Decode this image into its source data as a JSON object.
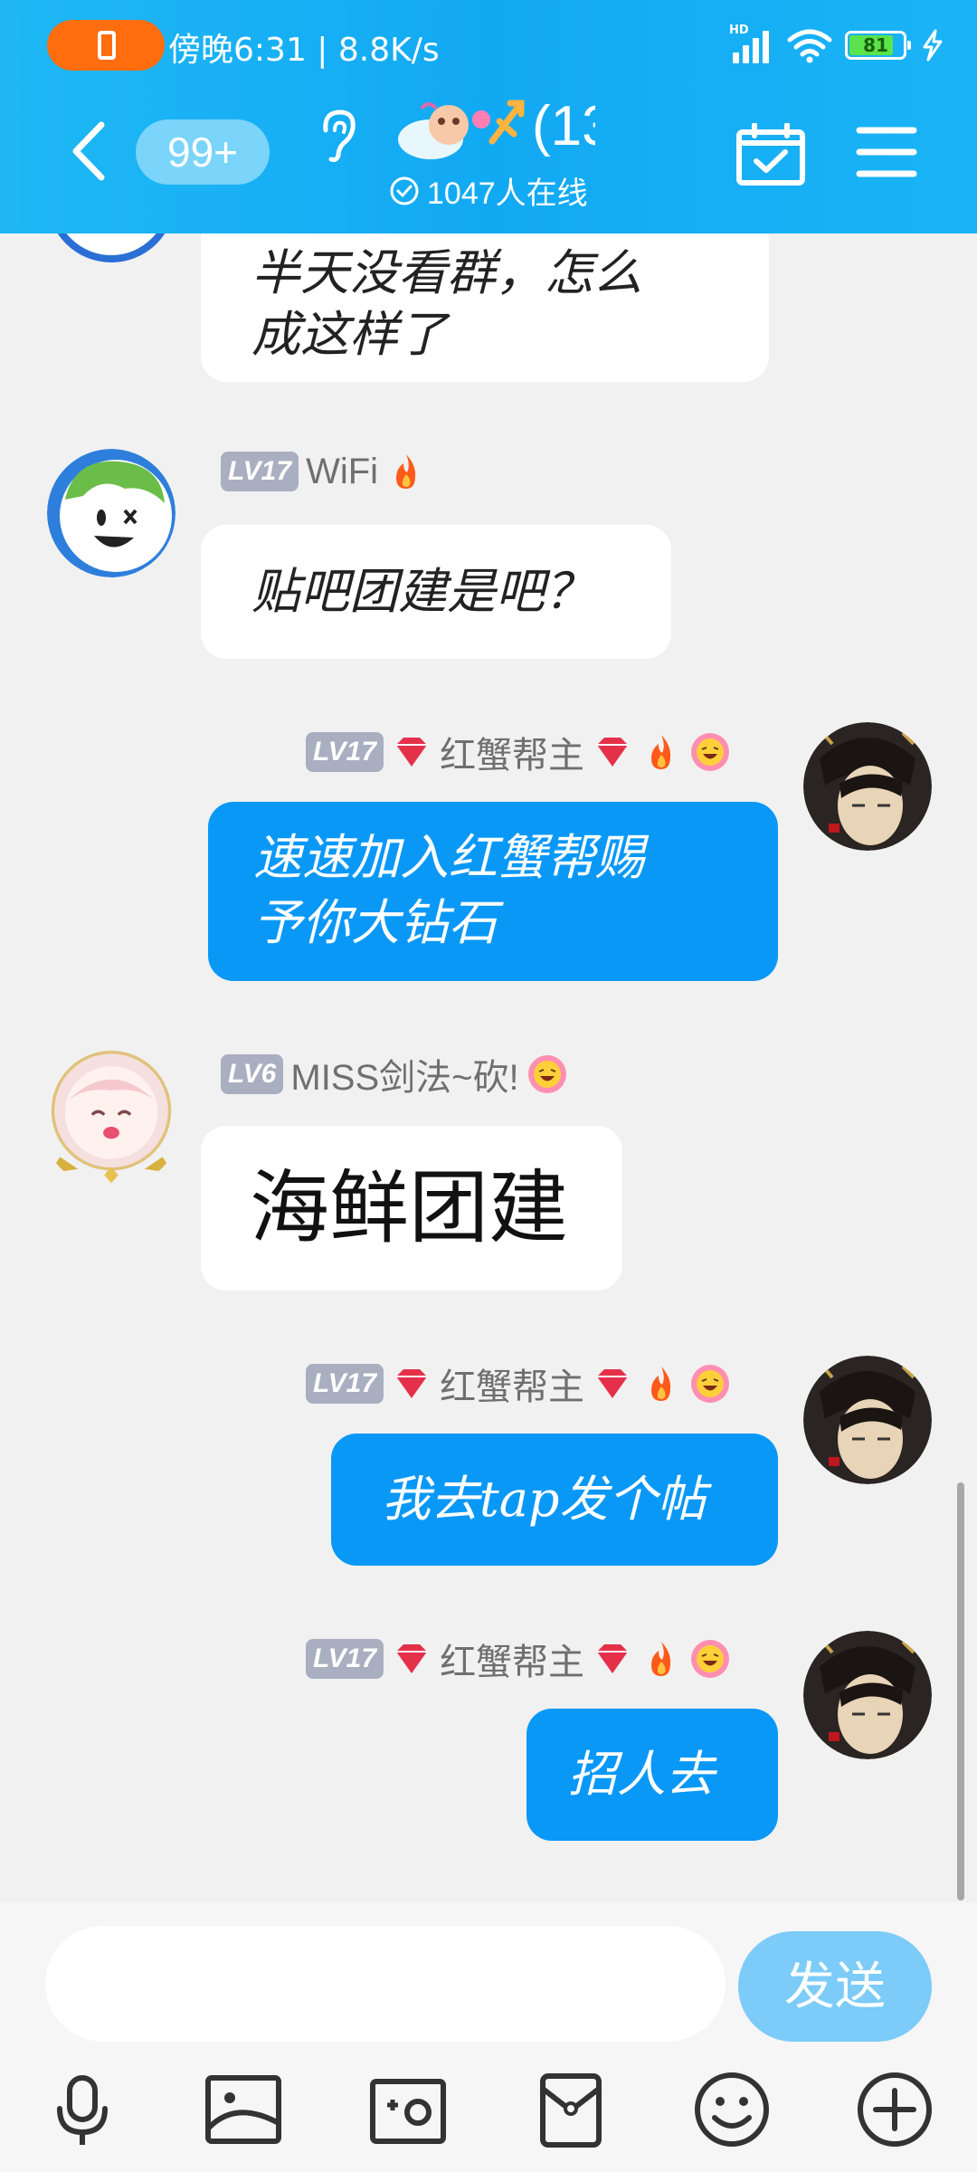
{
  "status_bar": {
    "time_speed": "傍晚6:31 | 8.8K/s",
    "network_tag": "HD",
    "battery": "81"
  },
  "header": {
    "unread_badge": "99+",
    "group_title_fragment": "(13",
    "online_count": "1047人在线"
  },
  "messages": [
    {
      "direction": "in",
      "text_lines": [
        "半天没看群，怎么",
        "成这样了"
      ]
    },
    {
      "direction": "in",
      "level": "LV17",
      "name": "WiFi",
      "text_lines": [
        "贴吧团建是吧？"
      ]
    },
    {
      "direction": "out",
      "level": "LV17",
      "name": "红蟹帮主",
      "text_lines": [
        "速速加入红蟹帮赐",
        "予你大钻石"
      ]
    },
    {
      "direction": "in",
      "level": "LV6",
      "name": "MISS剑法~砍!",
      "text_lines": [
        "海鲜团建"
      ]
    },
    {
      "direction": "out",
      "level": "LV17",
      "name": "红蟹帮主",
      "text_lines": [
        "我去tap发个帖"
      ]
    },
    {
      "direction": "out",
      "level": "LV17",
      "name": "红蟹帮主",
      "text_lines": [
        "招人去"
      ]
    }
  ],
  "input": {
    "send_label": "发送"
  },
  "colors": {
    "header_blue": "#12a9f3",
    "outgoing_bubble": "#0a98f7",
    "call_pill": "#ff6d0f",
    "send_button": "#7ccbf8"
  },
  "icons": [
    "back-icon",
    "ear-icon",
    "calendar-check-icon",
    "menu-icon",
    "microphone-icon",
    "image-icon",
    "camera-icon",
    "red-packet-icon",
    "emoji-icon",
    "plus-icon"
  ]
}
